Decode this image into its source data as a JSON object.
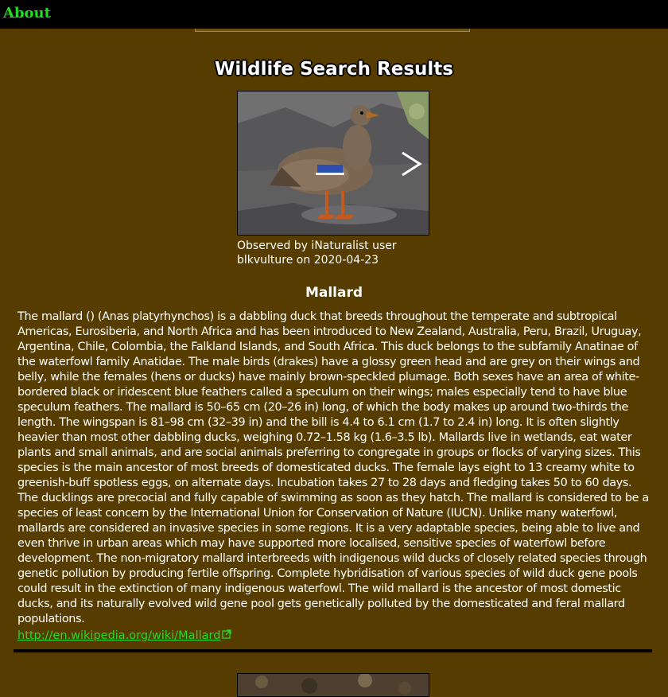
{
  "nav": {
    "about_label": "About"
  },
  "page": {
    "title": "Wildlife Search Results"
  },
  "result": {
    "photo_alt": "Mallard photo",
    "caption": "Observed by iNaturalist user blkvulture on 2020-04-23",
    "species_name": "Mallard",
    "description": "The mallard () (Anas platyrhynchos) is a dabbling duck that breeds throughout the temperate and subtropical Americas, Eurosiberia, and North Africa and has been introduced to New Zealand, Australia, Peru, Brazil, Uruguay, Argentina, Chile, Colombia, the Falkland Islands, and South Africa. This duck belongs to the subfamily Anatinae of the waterfowl family Anatidae. The male birds (drakes) have a glossy green head and are grey on their wings and belly, while the females (hens or ducks) have mainly brown-speckled plumage. Both sexes have an area of white-bordered black or iridescent blue feathers called a speculum on their wings; males especially tend to have blue speculum feathers. The mallard is 50–65 cm (20–26 in) long, of which the body makes up around two-thirds the length. The wingspan is 81–98 cm (32–39 in) and the bill is 4.4 to 6.1 cm (1.7 to 2.4 in) long. It is often slightly heavier than most other dabbling ducks, weighing 0.72–1.58 kg (1.6–3.5 lb). Mallards live in wetlands, eat water plants and small animals, and are social animals preferring to congregate in groups or flocks of varying sizes. This species is the main ancestor of most breeds of domesticated ducks. The female lays eight to 13 creamy white to greenish-buff spotless eggs, on alternate days. Incubation takes 27 to 28 days and fledging takes 50 to 60 days. The ducklings are precocial and fully capable of swimming as soon as they hatch. The mallard is considered to be a species of least concern by the International Union for Conservation of Nature (IUCN). Unlike many waterfowl, mallards are considered an invasive species in some regions. It is a very adaptable species, being able to live and even thrive in urban areas which may have supported more localised, sensitive species of waterfowl before development. The non-migratory mallard interbreeds with indigenous wild ducks of closely related species through genetic pollution by producing fertile offspring. Complete hybridisation of various species of wild duck gene pools could result in the extinction of many indigenous waterfowl. The wild mallard is the ancestor of most domestic ducks, and its naturally evolved wild gene pool gets genetically polluted by the domesticated and feral mallard populations.",
    "wiki_url": "http://en.wikipedia.org/wiki/Mallard"
  },
  "icons": {
    "next": "chevron-right-icon",
    "external": "external-link-icon"
  },
  "colors": {
    "page_background": "#573c00",
    "top_bar": "#000000",
    "link_green": "#22dd22",
    "text": "#ffffff"
  }
}
